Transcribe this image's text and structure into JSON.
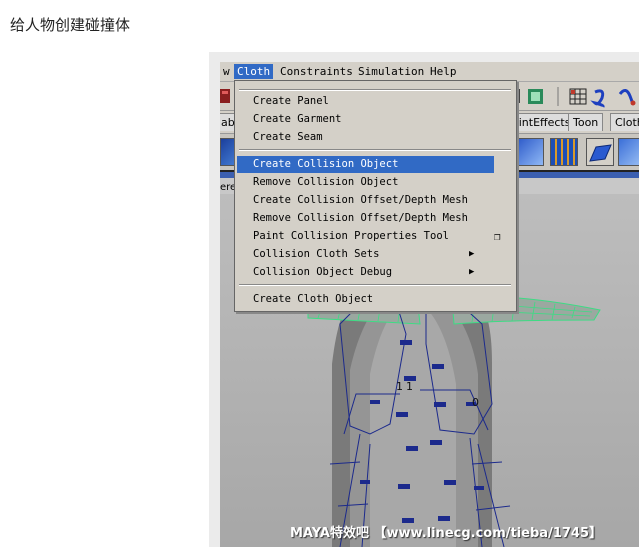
{
  "page": {
    "heading": "给人物创建碰撞体"
  },
  "menubar": {
    "items": [
      {
        "label": "w"
      },
      {
        "label": "Cloth"
      },
      {
        "label": "Constraints"
      },
      {
        "label": "Simulation"
      },
      {
        "label": "Help"
      }
    ]
  },
  "shelf_tabs": [
    "abc",
    "aintEffects",
    "Toon",
    "Cloth"
  ],
  "panel_label": "ere",
  "cloth_menu": {
    "items": [
      {
        "label": "Create Panel"
      },
      {
        "label": "Create Garment"
      },
      {
        "label": "Create Seam"
      },
      {
        "label": "Create Collision Object"
      },
      {
        "label": "Remove Collision Object"
      },
      {
        "label": "Create Collision Offset/Depth Mesh"
      },
      {
        "label": "Remove Collision Offset/Depth Mesh"
      },
      {
        "label": "Paint Collision Properties Tool"
      },
      {
        "label": "Collision Cloth Sets"
      },
      {
        "label": "Collision Object Debug"
      },
      {
        "label": "Create Cloth Object"
      }
    ],
    "selected": "Create Collision Object"
  },
  "viewport": {
    "labels": [
      "1",
      "1",
      "0"
    ]
  },
  "watermark": "MAYA特效吧 【www.linecg.com/tieba/1745】",
  "colors": {
    "selection": "#316ac5",
    "menu_bg": "#d4d0c8",
    "mesh_green": "#3ddc84",
    "cloth_lines": "#1c2a8c"
  }
}
